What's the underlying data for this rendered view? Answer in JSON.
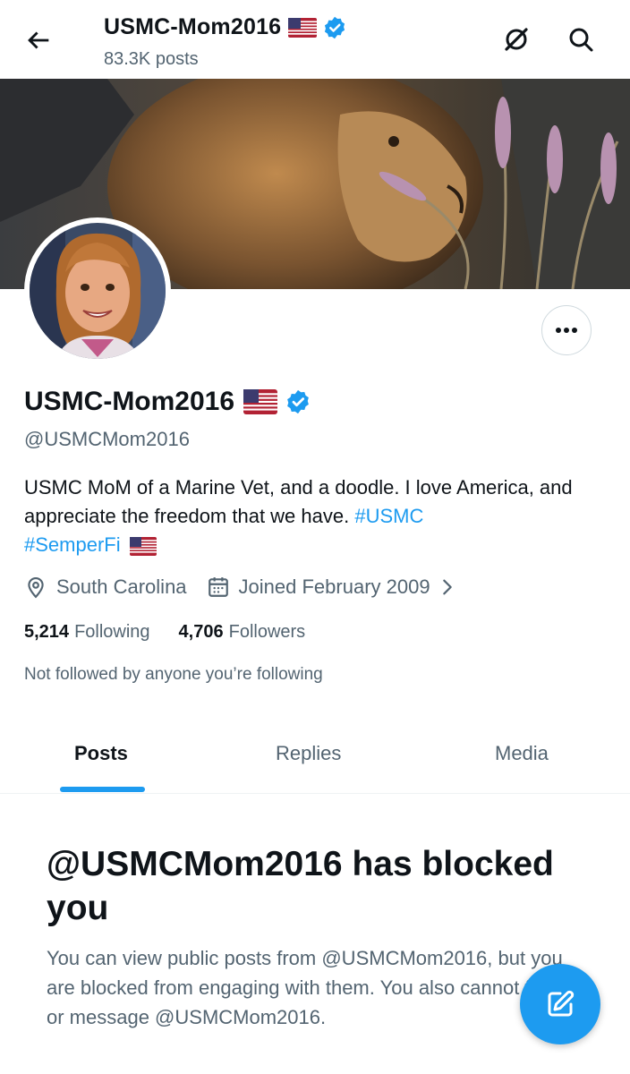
{
  "header": {
    "title": "USMC-Mom2016",
    "posts_count": "83.3K posts"
  },
  "profile": {
    "display_name": "USMC-Mom2016",
    "handle": "@USMCMom2016",
    "bio": {
      "text": "USMC MoM of a Marine Vet, and a doodle. I love America, and appreciate the freedom that we have.",
      "hashtag1": "#USMC",
      "hashtag2": "#SemperFi"
    },
    "location": "South Carolina",
    "joined": "Joined February 2009",
    "following_count": "5,214",
    "following_label": "Following",
    "followers_count": "4,706",
    "followers_label": "Followers",
    "not_followed_text": "Not followed by anyone you’re following"
  },
  "tabs": [
    {
      "label": "Posts",
      "active": true
    },
    {
      "label": "Replies",
      "active": false
    },
    {
      "label": "Media",
      "active": false
    }
  ],
  "blocked": {
    "title": "@USMCMom2016 has blocked you",
    "body": "You can view public posts from @USMCMom2016, but you are blocked from engaging with them. You also cannot follow or message @USMCMom2016."
  },
  "colors": {
    "accent": "#1d9bf0",
    "text_primary": "#0f1419",
    "text_secondary": "#536471"
  },
  "icons": [
    "back-arrow-icon",
    "grok-icon",
    "search-icon",
    "us-flag-icon",
    "verified-badge-icon",
    "more-icon",
    "location-icon",
    "calendar-icon",
    "chevron-right-icon",
    "compose-icon"
  ]
}
